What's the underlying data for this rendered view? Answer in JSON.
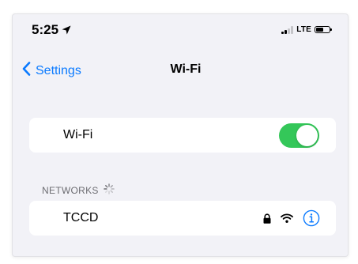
{
  "status_bar": {
    "time": "5:25",
    "network_type": "LTE",
    "icons": [
      "location-arrow-icon",
      "cellular-signal-icon",
      "battery-icon"
    ]
  },
  "nav": {
    "back_label": "Settings",
    "title": "Wi-Fi"
  },
  "wifi_toggle": {
    "label": "Wi-Fi",
    "enabled": true
  },
  "networks": {
    "header": "NETWORKS",
    "items": [
      {
        "name": "TCCD",
        "secured": true,
        "icons": [
          "lock-icon",
          "wifi-signal-icon",
          "info-icon"
        ]
      }
    ]
  },
  "colors": {
    "accent": "#0a7aff",
    "toggle_on": "#34c759",
    "background": "#f2f2f7",
    "card": "#ffffff",
    "section_text": "#6d6d72"
  }
}
